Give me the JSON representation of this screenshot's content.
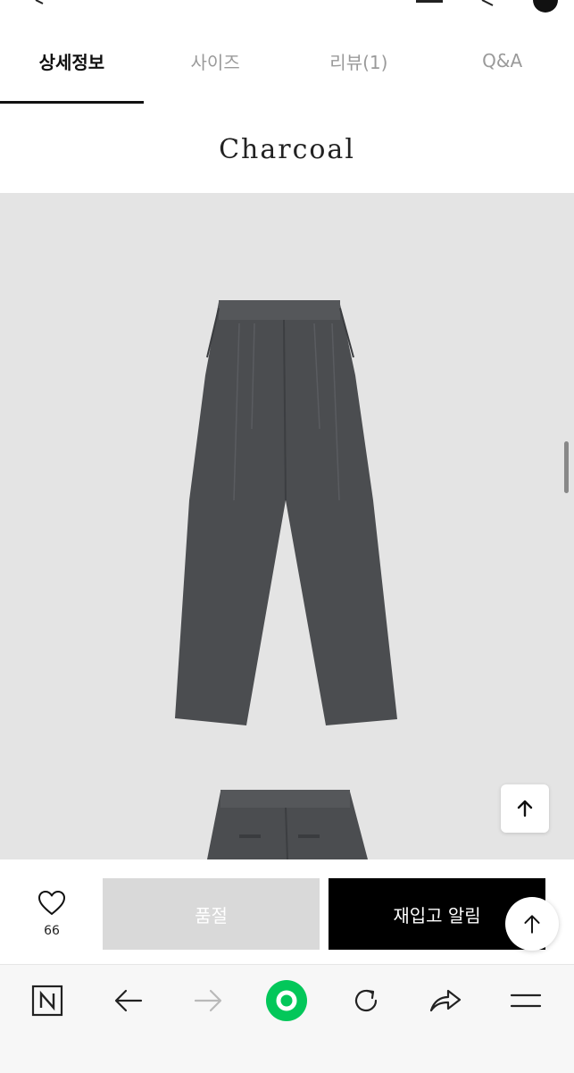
{
  "tabs": [
    {
      "label": "상세정보"
    },
    {
      "label": "사이즈"
    },
    {
      "label": "리뷰(1)"
    },
    {
      "label": "Q&A"
    }
  ],
  "product": {
    "color_name": "Charcoal"
  },
  "actions": {
    "like_count": "66",
    "soldout_label": "품절",
    "restock_label": "재입고 알림"
  },
  "icons": {
    "back_to_top": "arrow-up-icon",
    "like": "heart-icon",
    "browser": [
      "naver-n-icon",
      "back-arrow-icon",
      "forward-arrow-icon",
      "green-home-icon",
      "refresh-icon",
      "share-icon",
      "menu-icon"
    ]
  },
  "colors": {
    "accent": "#000000",
    "soldout_bg": "#d9d9d9",
    "naver_green": "#03c75a",
    "photo_bg": "#e4e4e4",
    "pants": "#4b4d50"
  }
}
